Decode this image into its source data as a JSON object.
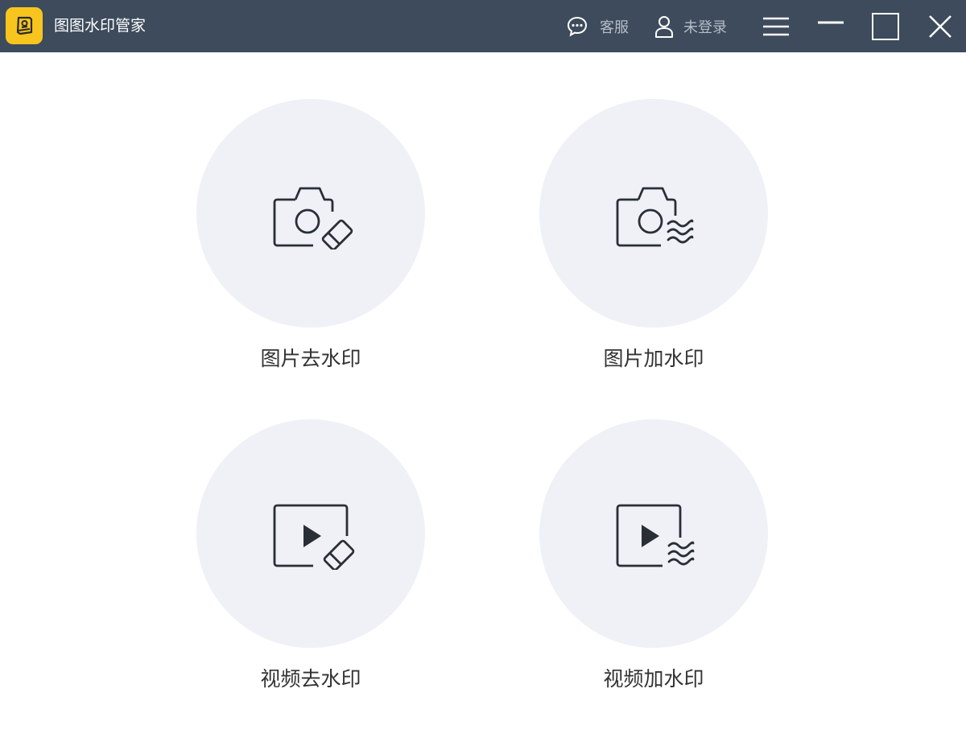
{
  "app": {
    "title": "图图水印管家",
    "logo_icon": "book-logo-icon",
    "colors": {
      "titlebar": "#3d4b5c",
      "logo": "#f7c51e",
      "circle": "#eff1f6",
      "icon_stroke": "#2a2f36"
    }
  },
  "header": {
    "service_label": "客服",
    "login_label": "未登录"
  },
  "features": [
    {
      "label": "图片去水印",
      "icon": "camera-eraser-icon"
    },
    {
      "label": "图片加水印",
      "icon": "camera-watermark-icon"
    },
    {
      "label": "视频去水印",
      "icon": "video-eraser-icon"
    },
    {
      "label": "视频加水印",
      "icon": "video-watermark-icon"
    }
  ]
}
